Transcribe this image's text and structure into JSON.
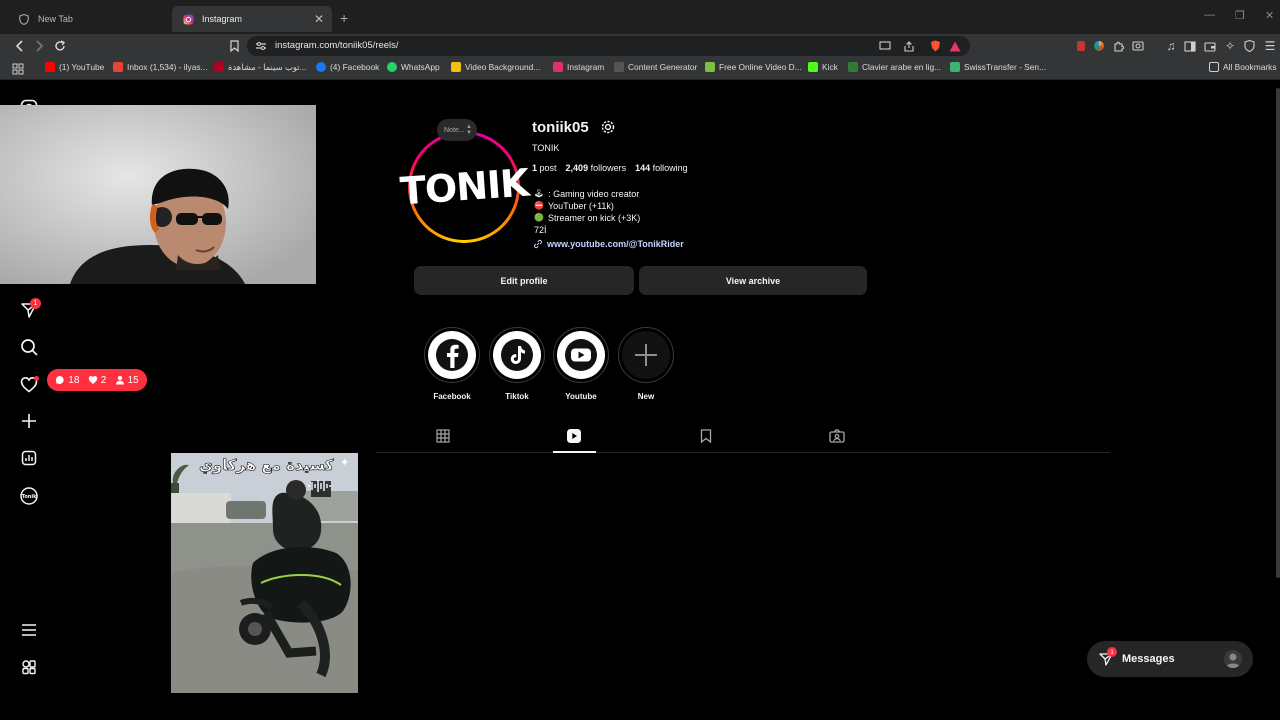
{
  "browser": {
    "tabs": [
      {
        "label": "New Tab",
        "active": false
      },
      {
        "label": "Instagram",
        "active": true
      }
    ],
    "url": "instagram.com/toniik05/reels/",
    "bookmarks": [
      {
        "label": "(1) YouTube",
        "color": "#ff0000"
      },
      {
        "label": "Inbox (1,534) - ilyas...",
        "color": "#ea4335"
      },
      {
        "label": "توب سينما - مشاهدة...",
        "color": "#b00020"
      },
      {
        "label": "(4) Facebook",
        "color": "#1877f2"
      },
      {
        "label": "WhatsApp",
        "color": "#25d366"
      },
      {
        "label": "Video Background...",
        "color": "#f4c20d"
      },
      {
        "label": "Instagram",
        "color": "#e1306c"
      },
      {
        "label": "Content Generator",
        "color": "#222222"
      },
      {
        "label": "Free Online Video D...",
        "color": "#7cc242"
      },
      {
        "label": "Kick",
        "color": "#53fc18"
      },
      {
        "label": "Clavier arabe en lig...",
        "color": "#2e7d32"
      },
      {
        "label": "SwissTransfer - Sen...",
        "color": "#3cb371"
      }
    ],
    "all_bookmarks": "All Bookmarks"
  },
  "sidebar": {
    "notifications_badge": "1",
    "pill": {
      "comments": "18",
      "likes": "2",
      "followers": "15"
    }
  },
  "profile": {
    "avatar_text": "TONIK",
    "note": "Note...",
    "username": "toniik05",
    "full_name": "TONIK",
    "posts_count": "1",
    "posts_label": "post",
    "followers_count": "2,409",
    "followers_label": "followers",
    "following_count": "144",
    "following_label": "following",
    "bio": [
      {
        "icon": "🕹",
        "text": ": Gaming video creator"
      },
      {
        "icon": "⛔",
        "text": "YouTuber (+11k)"
      },
      {
        "icon": "🟢",
        "text": "Streamer on kick (+3K)"
      },
      {
        "icon": "",
        "text": "72İ"
      }
    ],
    "link": "www.youtube.com/@TonikRider",
    "edit_profile": "Edit profile",
    "view_archive": "View archive"
  },
  "highlights": [
    {
      "label": "Facebook",
      "icon": "facebook-icon"
    },
    {
      "label": "Tiktok",
      "icon": "tiktok-icon"
    },
    {
      "label": "Youtube",
      "icon": "youtube-icon"
    },
    {
      "label": "New",
      "icon": "plus-icon"
    }
  ],
  "reel": {
    "caption": "كسيدة مع هركاوي"
  },
  "messages": {
    "label": "Messages",
    "badge": "1"
  }
}
